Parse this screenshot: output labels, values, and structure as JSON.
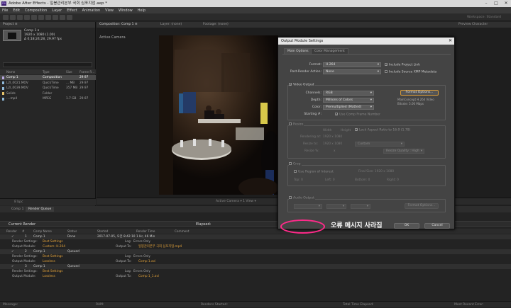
{
  "window": {
    "title": "Adobe After Effects - 일봉관리본부 국회 심포지엄.aep *",
    "app_icon": "Ae"
  },
  "menu": [
    "File",
    "Edit",
    "Composition",
    "Layer",
    "Effect",
    "Animation",
    "View",
    "Window",
    "Help"
  ],
  "toolbar": {
    "workspace": "Workspace:   Standard"
  },
  "project": {
    "tab": "Project ≡",
    "comp_name": "Comp 1 ▾",
    "comp_dims": "1920 x 1080 (1.00)",
    "comp_dur": "Δ 0;18;24;28, 29.97 fps",
    "columns": [
      "Name",
      "Type",
      "Size",
      "Frame R..."
    ],
    "rows": [
      {
        "name": "Comp 1",
        "type": "Composition",
        "size": "",
        "fps": "29.97",
        "color": "#b7a8e0",
        "selected": true
      },
      {
        "name": "L2I_0021.MOV",
        "type": "QuickTime",
        "size": "... MB",
        "fps": "29.97",
        "color": "#8fb8d8",
        "selected": false
      },
      {
        "name": "L2I_0039.MOV",
        "type": "QuickTime",
        "size": "357 MB",
        "fps": "29.97",
        "color": "#8fb8d8",
        "selected": false
      },
      {
        "name": "Solids",
        "type": "Folder",
        "size": "",
        "fps": "",
        "color": "#e6c36a",
        "selected": false
      },
      {
        "name": "....mp4",
        "type": "MPEG",
        "size": "1.7 GB",
        "fps": "29.97",
        "color": "#8fb8d8",
        "selected": false
      }
    ],
    "footer": "8 bpc"
  },
  "composition": {
    "tabs": [
      "Composition: Comp 1 ≡",
      "Layer: (none)",
      "Footage: (none)"
    ],
    "right_tab": "Preview   Character",
    "active_camera": "Active Camera",
    "footer": "Active Camera ▾    1 View ▾"
  },
  "render_queue": {
    "tabs": [
      "Comp 1",
      "Render Queue"
    ],
    "current_render": "Current Render",
    "elapsed": "Elapsed:",
    "columns": [
      "Render",
      "#",
      "Comp Name",
      "Status",
      "Started",
      "Render Time",
      "Comment"
    ],
    "rows": [
      {
        "kind": "main",
        "num": "1",
        "comp": "Comp 1",
        "status": "Done",
        "started": "2017-07-05, 오전 8:42:10",
        "time": "1 Hr, 46 Min"
      },
      {
        "kind": "rs",
        "label": "Render Settings:",
        "value": "Best Settings",
        "log_label": "Log:",
        "log": "Errors Only"
      },
      {
        "kind": "om",
        "label": "Output Module:",
        "value": "Custom: H.264",
        "out_label": "Output To:",
        "out": "일봉관리본부 국회 심포지엄.mp4"
      },
      {
        "kind": "main",
        "num": "2",
        "comp": "Comp 1",
        "status": "Queued",
        "started": "",
        "time": ""
      },
      {
        "kind": "rs",
        "label": "Render Settings:",
        "value": "Best Settings",
        "log_label": "Log:",
        "log": "Errors Only"
      },
      {
        "kind": "om",
        "label": "Output Module:",
        "value": "Lossless",
        "out_label": "Output To:",
        "out": "Comp 1.avi"
      },
      {
        "kind": "main",
        "num": "3",
        "comp": "Comp 1",
        "status": "Queued",
        "started": "",
        "time": ""
      },
      {
        "kind": "rs",
        "label": "Render Settings:",
        "value": "Best Settings",
        "log_label": "Log:",
        "log": "Errors Only"
      },
      {
        "kind": "om",
        "label": "Output Module:",
        "value": "Lossless",
        "out_label": "Output To:",
        "out": "Comp 1_1.avi"
      }
    ]
  },
  "status_bar": {
    "message": "Message:",
    "ram": "RAM:",
    "renders_started": "Renders Started:",
    "total_elapsed": "Total Time Elapsed:",
    "recent_error": "Most Recent Error:"
  },
  "dialog": {
    "title": "Output Module Settings",
    "tabs": [
      "Main Options",
      "Color Management"
    ],
    "format_label": "Format:",
    "format_value": "H.264",
    "post_render_label": "Post-Render Action:",
    "post_render_value": "None",
    "include_project_link": "Include Project Link",
    "include_xmp": "Include Source XMP Metadata",
    "video_output": "Video Output",
    "channels_label": "Channels:",
    "channels_value": "RGB",
    "depth_label": "Depth:",
    "depth_value": "Millions of Colors",
    "color_label": "Color:",
    "color_value": "Premultiplied (Matted)",
    "starting_label": "Starting #:",
    "use_comp_frame": "Use Comp Frame Number",
    "format_options": "Format Options...",
    "codec_info_1": "MainConcept H.264 Video",
    "codec_info_2": "Bitrate: 5.00 Mbps",
    "resize": "Resize",
    "resize_cols": [
      "Width",
      "Height"
    ],
    "lock_aspect": "Lock Aspect Ratio to 16:9 (1.78)",
    "rendering_at_label": "Rendering at:",
    "rendering_at": "1920 x 1080",
    "resize_to_label": "Resize to:",
    "resize_to": "1920 x 1080",
    "custom": "Custom",
    "resize_pct_label": "Resize %:",
    "resize_pct": "x",
    "resize_quality": "Resize Quality : High",
    "crop": "Crop",
    "use_roi": "Use Region of Interest",
    "final_size": "Final Size: 1920 x 1080",
    "crop_fields": [
      "Top: 0",
      "Left: 0",
      "Bottom: 0",
      "Right: 0"
    ],
    "audio_output": "Audio Output",
    "audio_format_options": "Format Options...",
    "ok": "OK",
    "cancel": "Cancel"
  },
  "annotation": {
    "text": "오류 메시지 사라짐",
    "color": "#ff2a8a"
  }
}
